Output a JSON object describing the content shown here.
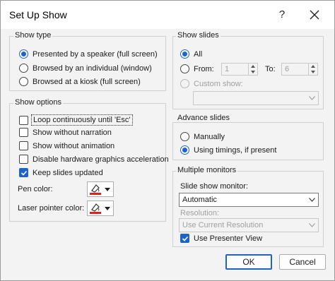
{
  "window": {
    "title": "Set Up Show",
    "help_label": "?"
  },
  "show_type": {
    "title": "Show type",
    "options": [
      {
        "label": "Presented by a speaker (full screen)",
        "selected": true
      },
      {
        "label": "Browsed by an individual (window)",
        "selected": false
      },
      {
        "label": "Browsed at a kiosk (full screen)",
        "selected": false
      }
    ]
  },
  "show_options": {
    "title": "Show options",
    "checks": [
      {
        "label": "Loop continuously until 'Esc'",
        "checked": false
      },
      {
        "label": "Show without narration",
        "checked": false
      },
      {
        "label": "Show without animation",
        "checked": false
      },
      {
        "label": "Disable hardware graphics acceleration",
        "checked": false
      },
      {
        "label": "Keep slides updated",
        "checked": true
      }
    ],
    "pen_color_label": "Pen color:",
    "laser_color_label": "Laser pointer color:",
    "pen_color": "#e02020",
    "laser_color": "#e02020"
  },
  "show_slides": {
    "title": "Show slides",
    "all_label": "All",
    "from_label": "From:",
    "to_label": "To:",
    "from_value": "1",
    "to_value": "6",
    "custom_label": "Custom show:",
    "custom_value": ""
  },
  "advance_slides": {
    "title": "Advance slides",
    "options": [
      {
        "label": "Manually",
        "selected": false
      },
      {
        "label": "Using timings, if present",
        "selected": true
      }
    ]
  },
  "multiple_monitors": {
    "title": "Multiple monitors",
    "monitor_label": "Slide show monitor:",
    "monitor_value": "Automatic",
    "resolution_label": "Resolution:",
    "resolution_value": "Use Current Resolution",
    "presenter_label": "Use Presenter View",
    "presenter_checked": true
  },
  "buttons": {
    "ok": "OK",
    "cancel": "Cancel"
  },
  "colors": {
    "accent": "#1d63c9"
  }
}
